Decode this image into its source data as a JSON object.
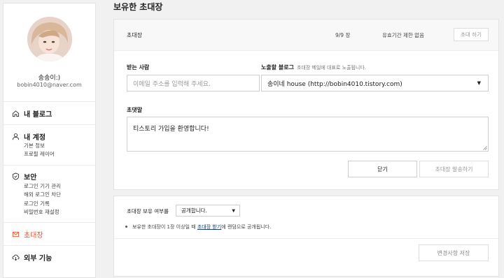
{
  "sidebar": {
    "nickname": "송송이:)",
    "email": "bobin4010@naver.com",
    "sections": {
      "blog": {
        "label": "내 블로그"
      },
      "account": {
        "label": "내 계정",
        "items": [
          "기본 정보",
          "프로필 레이어"
        ]
      },
      "security": {
        "label": "보안",
        "items": [
          "로그인 기기 관리",
          "해외 로그인 차단",
          "로그인 기록",
          "비밀번호 재설정"
        ]
      },
      "invite": {
        "label": "초대장"
      },
      "external": {
        "label": "외부 기능"
      }
    }
  },
  "main": {
    "page_title": "보유한 초대장",
    "invite_card": {
      "label": "초대장",
      "count": "9/9 장",
      "expiry": "유효기간 제한 없음",
      "invite_button": "초대 하기"
    },
    "form": {
      "recipient_label": "받는 사람",
      "recipient_placeholder": "이메일 주소를 입력해 주세요.",
      "blog_label": "노출할 블로그",
      "blog_hint": "초대장 메일에 대표로 노출됩니다.",
      "blog_value": "송이네 house (http://bobin4010.tistory.com)",
      "message_label": "초댓말",
      "message_value": "티스토리 가입을 환영합니다!",
      "close_button": "닫기",
      "send_button": "초대장 발송하기"
    },
    "ownership": {
      "label": "초대장 보유 여부를",
      "select_value": "공개합니다.",
      "note_before": "보유한 초대장이 1장 이상일 때 ",
      "note_link": "초대장 받기",
      "note_after": "에 랜덤으로 공개됩니다.",
      "save_button": "변경사항 저장"
    }
  },
  "colors": {
    "accent": "#e8542e",
    "link": "#1a3e7a"
  }
}
